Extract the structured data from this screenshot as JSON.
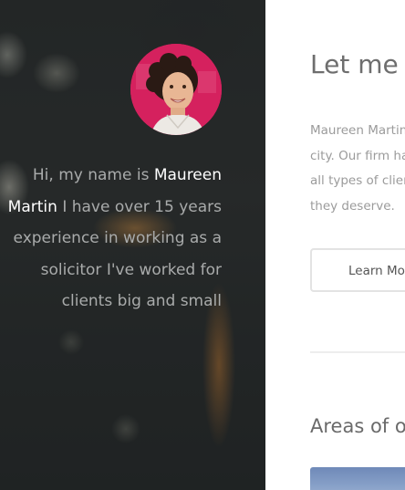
{
  "hero": {
    "avatar_alt": "profile photo",
    "intro_prefix": "Hi, my name is ",
    "intro_name": "Maureen Martin",
    "intro_suffix": " I have over 15 years experience in working as a solicitor I've worked for clients big and small"
  },
  "main": {
    "headline": "Let me t",
    "bio_lines": [
      "Maureen Martin",
      "city. Our firm ha",
      "all types of clien",
      "they deserve."
    ],
    "learn_more_label": "Learn Mo",
    "areas_title": "Areas of ou"
  },
  "colors": {
    "panel_dark": "#2b2d2c",
    "avatar_bg": "#d21f5b",
    "name_highlight": "#ffffff",
    "body_text": "#9b9b9b"
  }
}
